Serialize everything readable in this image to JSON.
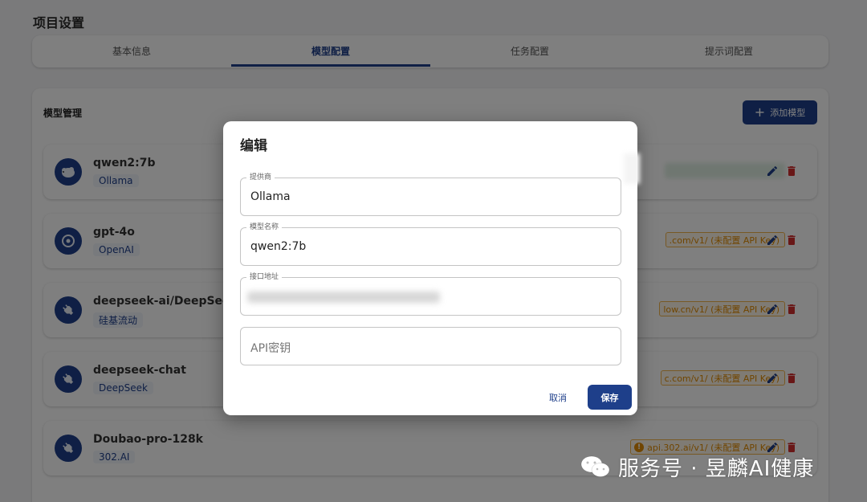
{
  "page": {
    "title": "项目设置"
  },
  "tabs": [
    {
      "label": "基本信息"
    },
    {
      "label": "模型配置"
    },
    {
      "label": "任务配置"
    },
    {
      "label": "提示词配置"
    }
  ],
  "active_tab": "模型配置",
  "model_panel": {
    "title": "模型管理",
    "add_button_label": "添加模型",
    "models": [
      {
        "name": "qwen2:7b",
        "provider": "Ollama",
        "endpoint": "",
        "avatar_icon": "sheep-icon"
      },
      {
        "name": "gpt-4o",
        "provider": "OpenAI",
        "endpoint": ".com/v1/ (未配置 API Key)",
        "avatar_icon": "openai-icon"
      },
      {
        "name": "deepseek-ai/DeepSeek-",
        "provider": "硅基流动",
        "endpoint": "low.cn/v1/ (未配置 API Key)",
        "avatar_icon": "plug-icon"
      },
      {
        "name": "deepseek-chat",
        "provider": "DeepSeek",
        "endpoint": "c.com/v1/ (未配置 API Key)",
        "avatar_icon": "plug-icon"
      },
      {
        "name": "Doubao-pro-128k",
        "provider": "302.AI",
        "endpoint": "api.302.ai/v1/ (未配置 API Key)",
        "avatar_icon": "plug-icon"
      }
    ]
  },
  "dialog": {
    "title": "编辑",
    "provider_field": {
      "label": "提供商",
      "value": "Ollama"
    },
    "model_name_field": {
      "label": "模型名称",
      "value": "qwen2:7b"
    },
    "endpoint_field": {
      "label": "接口地址",
      "value": ""
    },
    "api_key_field": {
      "placeholder": "API密钥"
    },
    "cancel_label": "取消",
    "save_label": "保存"
  },
  "watermark": {
    "text": "服务号 · 昱麟AI健康"
  },
  "colors": {
    "primary": "#1e3f8a",
    "warning": "#e08a00",
    "danger": "#d32f2f"
  }
}
